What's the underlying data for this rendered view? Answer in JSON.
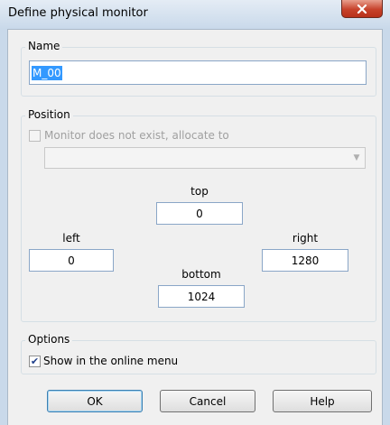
{
  "window": {
    "title": "Define physical monitor"
  },
  "name_group": {
    "label": "Name",
    "value": "M_00"
  },
  "position_group": {
    "label": "Position",
    "allocate_label": "Monitor does not exist, allocate to",
    "allocate_checked": false,
    "allocate_select_value": "",
    "top_label": "top",
    "top_value": "0",
    "left_label": "left",
    "left_value": "0",
    "right_label": "right",
    "right_value": "1280",
    "bottom_label": "bottom",
    "bottom_value": "1024"
  },
  "options_group": {
    "label": "Options",
    "show_online_label": "Show in the online menu",
    "show_online_checked": true
  },
  "buttons": {
    "ok": "OK",
    "cancel": "Cancel",
    "help": "Help"
  },
  "icons": {
    "close": "close-icon",
    "check": "checkmark-icon",
    "dropdown": "chevron-down-icon"
  }
}
